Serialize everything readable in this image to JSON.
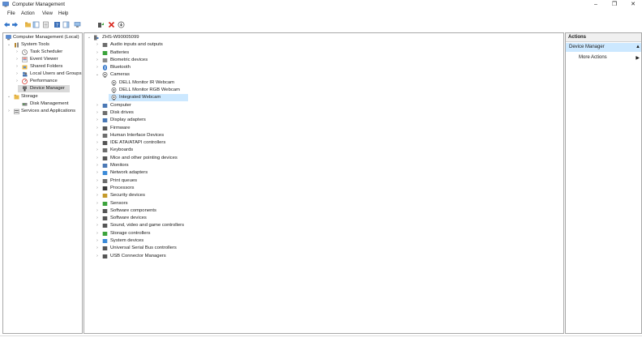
{
  "window": {
    "title": "Computer Management",
    "minimize_glyph": "–",
    "maximize_glyph": "❐",
    "close_glyph": "✕"
  },
  "menu": [
    "File",
    "Action",
    "View",
    "Help"
  ],
  "tree": {
    "root": "Computer Management (Local)",
    "system_tools": "System Tools",
    "task_scheduler": "Task Scheduler",
    "event_viewer": "Event Viewer",
    "shared_folders": "Shared Folders",
    "local_users": "Local Users and Groups",
    "performance": "Performance",
    "device_manager": "Device Manager",
    "storage": "Storage",
    "disk_management": "Disk Management",
    "services": "Services and Applications"
  },
  "devices": {
    "computer_name": "ZHS-W90005099",
    "categories": [
      "Audio inputs and outputs",
      "Batteries",
      "Biometric devices",
      "Bluetooth",
      "Cameras",
      "DELL Monitor IR Webcam",
      "DELL Monitor RGB Webcam",
      "Integrated Webcam",
      "Computer",
      "Disk drives",
      "Display adapters",
      "Firmware",
      "Human Interface Devices",
      "IDE ATA/ATAPI controllers",
      "Keyboards",
      "Mice and other pointing devices",
      "Monitors",
      "Network adapters",
      "Print queues",
      "Processors",
      "Security devices",
      "Sensors",
      "Software components",
      "Software devices",
      "Sound, video and game controllers",
      "Storage controllers",
      "System devices",
      "Universal Serial Bus controllers",
      "USB Connector Managers"
    ]
  },
  "actions": {
    "header": "Actions",
    "section": "Device Manager",
    "more": "More Actions"
  },
  "colors": {
    "selection": "#cce8ff",
    "border": "#a8a8a8"
  }
}
